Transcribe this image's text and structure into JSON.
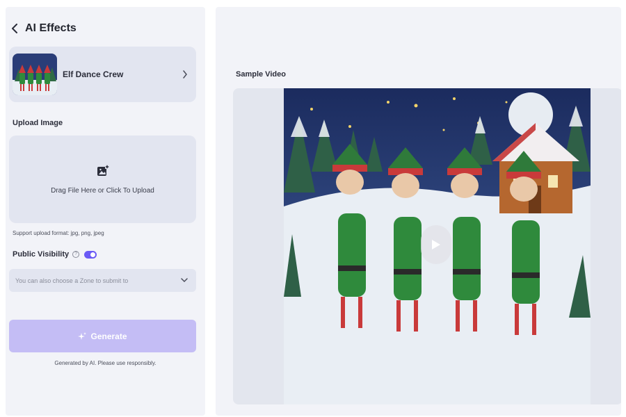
{
  "header": {
    "title": "AI Effects"
  },
  "effect": {
    "name": "Elf Dance Crew"
  },
  "upload": {
    "section_label": "Upload Image",
    "prompt": "Drag File Here or Click To Upload",
    "format_note": "Support upload format: jpg, png, jpeg"
  },
  "visibility": {
    "label": "Public Visibility",
    "enabled": true
  },
  "zone": {
    "placeholder": "You can also choose a Zone to submit to"
  },
  "generate": {
    "label": "Generate",
    "disclaimer": "Generated by AI. Please use responsibly."
  },
  "preview": {
    "label": "Sample Video"
  },
  "colors": {
    "accent": "#6a5af5",
    "generate_disabled": "#c4bdf5",
    "panel_bg": "#f2f3f8",
    "field_bg": "#e2e5f0"
  },
  "icons": [
    "chevron-left-icon",
    "chevron-right-icon",
    "image-upload-icon",
    "help-icon",
    "chevron-down-icon",
    "sparkle-icon",
    "play-icon"
  ]
}
